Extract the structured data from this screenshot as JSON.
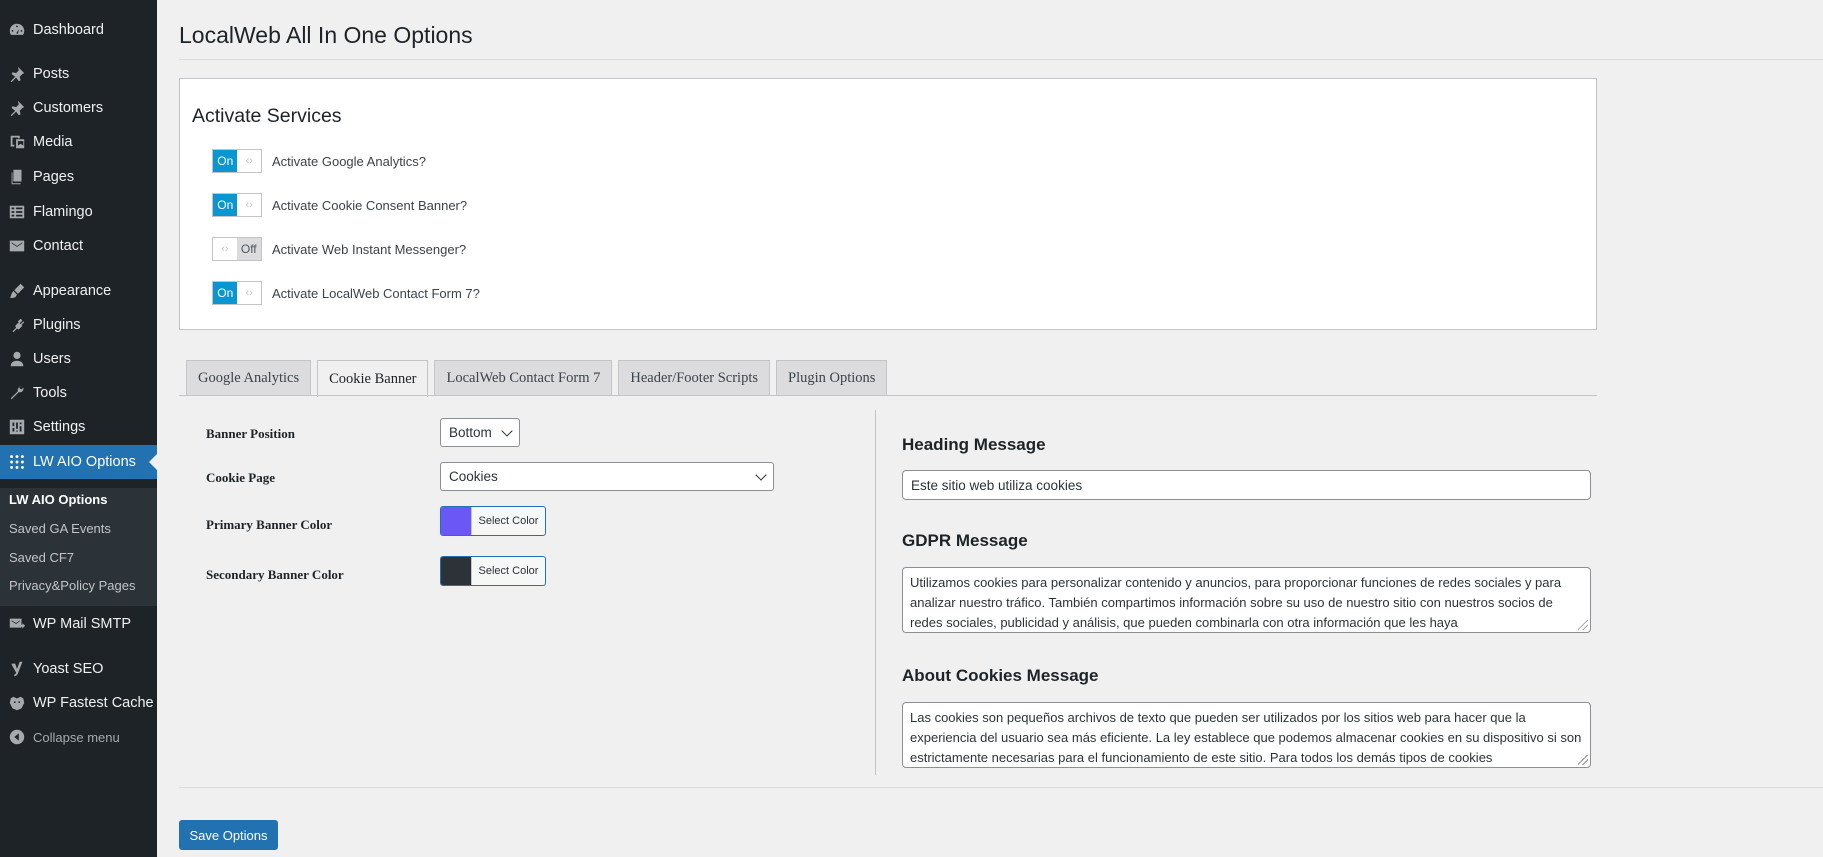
{
  "page_title": "LocalWeb All In One Options",
  "sidebar": {
    "items": [
      {
        "label": "Dashboard",
        "icon": "dashboard-icon"
      },
      {
        "label": "Posts",
        "icon": "pin-icon"
      },
      {
        "label": "Customers",
        "icon": "pin-icon"
      },
      {
        "label": "Media",
        "icon": "media-icon"
      },
      {
        "label": "Pages",
        "icon": "pages-icon"
      },
      {
        "label": "Flamingo",
        "icon": "list-icon"
      },
      {
        "label": "Contact",
        "icon": "envelope-icon"
      },
      {
        "label": "Appearance",
        "icon": "brush-icon"
      },
      {
        "label": "Plugins",
        "icon": "plug-icon"
      },
      {
        "label": "Users",
        "icon": "user-icon"
      },
      {
        "label": "Tools",
        "icon": "wrench-icon"
      },
      {
        "label": "Settings",
        "icon": "settings-icon"
      },
      {
        "label": "LW AIO Options",
        "icon": "grid-dots-icon"
      },
      {
        "label": "WP Mail SMTP",
        "icon": "mail-icon"
      },
      {
        "label": "Yoast SEO",
        "icon": "yoast-icon"
      },
      {
        "label": "WP Fastest Cache",
        "icon": "cheetah-icon"
      },
      {
        "label": "Collapse menu",
        "icon": "collapse-icon"
      }
    ],
    "submenu": [
      "LW AIO Options",
      "Saved GA Events",
      "Saved CF7",
      "Privacy&Policy Pages"
    ]
  },
  "services": {
    "heading": "Activate Services",
    "on_label": "On",
    "off_label": "Off",
    "rows": [
      {
        "label": "Activate Google Analytics?",
        "state": "On"
      },
      {
        "label": "Activate Cookie Consent Banner?",
        "state": "On"
      },
      {
        "label": "Activate Web Instant Messenger?",
        "state": "Off"
      },
      {
        "label": "Activate LocalWeb Contact Form 7?",
        "state": "On"
      }
    ]
  },
  "tabs": [
    {
      "label": "Google Analytics",
      "active": false
    },
    {
      "label": "Cookie Banner",
      "active": true
    },
    {
      "label": "LocalWeb Contact Form 7",
      "active": false
    },
    {
      "label": "Header/Footer Scripts",
      "active": false
    },
    {
      "label": "Plugin Options",
      "active": false
    }
  ],
  "cookie_banner": {
    "banner_position_label": "Banner Position",
    "banner_position_value": "Bottom",
    "cookie_page_label": "Cookie Page",
    "cookie_page_value": "Cookies",
    "primary_color_label": "Primary Banner Color",
    "primary_color": "#6b57f5",
    "secondary_color_label": "Secondary Banner Color",
    "secondary_color": "#2c3338",
    "select_color_label": "Select Color",
    "heading_message_label": "Heading Message",
    "heading_message_value": "Este sitio web utiliza cookies",
    "gdpr_message_label": "GDPR Message",
    "gdpr_message_value": "Utilizamos cookies para personalizar contenido y anuncios, para proporcionar funciones de redes sociales y para analizar nuestro tráfico. También compartimos información sobre su uso de nuestro sitio con nuestros socios de redes sociales, publicidad y análisis, que pueden combinarla con otra información que les haya",
    "about_cookies_label": "About Cookies Message",
    "about_cookies_value": "Las cookies son pequeños archivos de texto que pueden ser utilizados por los sitios web para hacer que la experiencia del usuario sea más eficiente. La ley establece que podemos almacenar cookies en su dispositivo si son estrictamente necesarias para el funcionamiento de este sitio. Para todos los demás tipos de cookies"
  },
  "save_button": "Save Options",
  "colors": {
    "sidebar_bg": "#1d2327",
    "accent": "#2271b1",
    "toggle_on": "#0a97d1"
  }
}
